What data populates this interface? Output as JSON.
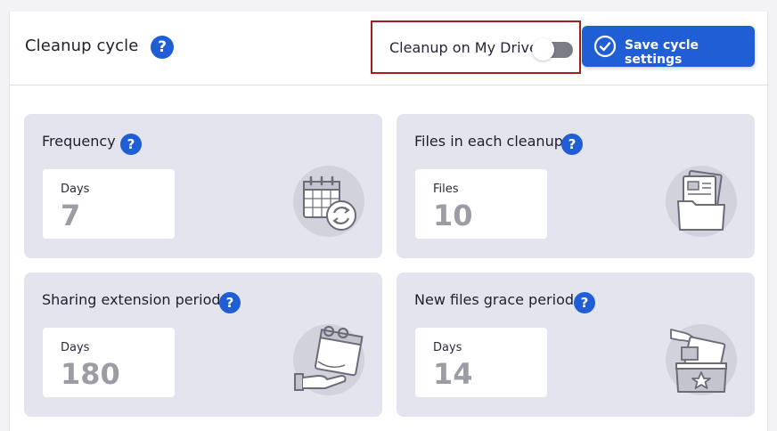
{
  "header": {
    "title": "Cleanup cycle",
    "help_glyph": "?",
    "toggle": {
      "label": "Cleanup on My Drive",
      "on": false
    },
    "save_button": {
      "label": "Save cycle settings",
      "icon": "check-circle-icon"
    }
  },
  "cards": [
    {
      "title": "Frequency",
      "unit": "Days",
      "value": "7",
      "icon": "calendar-sync-icon"
    },
    {
      "title": "Files in each cleanup",
      "unit": "Files",
      "value": "10",
      "icon": "folder-files-icon"
    },
    {
      "title": "Sharing extension period",
      "unit": "Days",
      "value": "180",
      "icon": "calendar-hand-icon"
    },
    {
      "title": "New files grace period",
      "unit": "Days",
      "value": "14",
      "icon": "box-star-icon"
    }
  ],
  "colors": {
    "accent": "#1f5ed4",
    "card_bg": "#e4e4ef",
    "highlight_border": "#a31e1e"
  }
}
